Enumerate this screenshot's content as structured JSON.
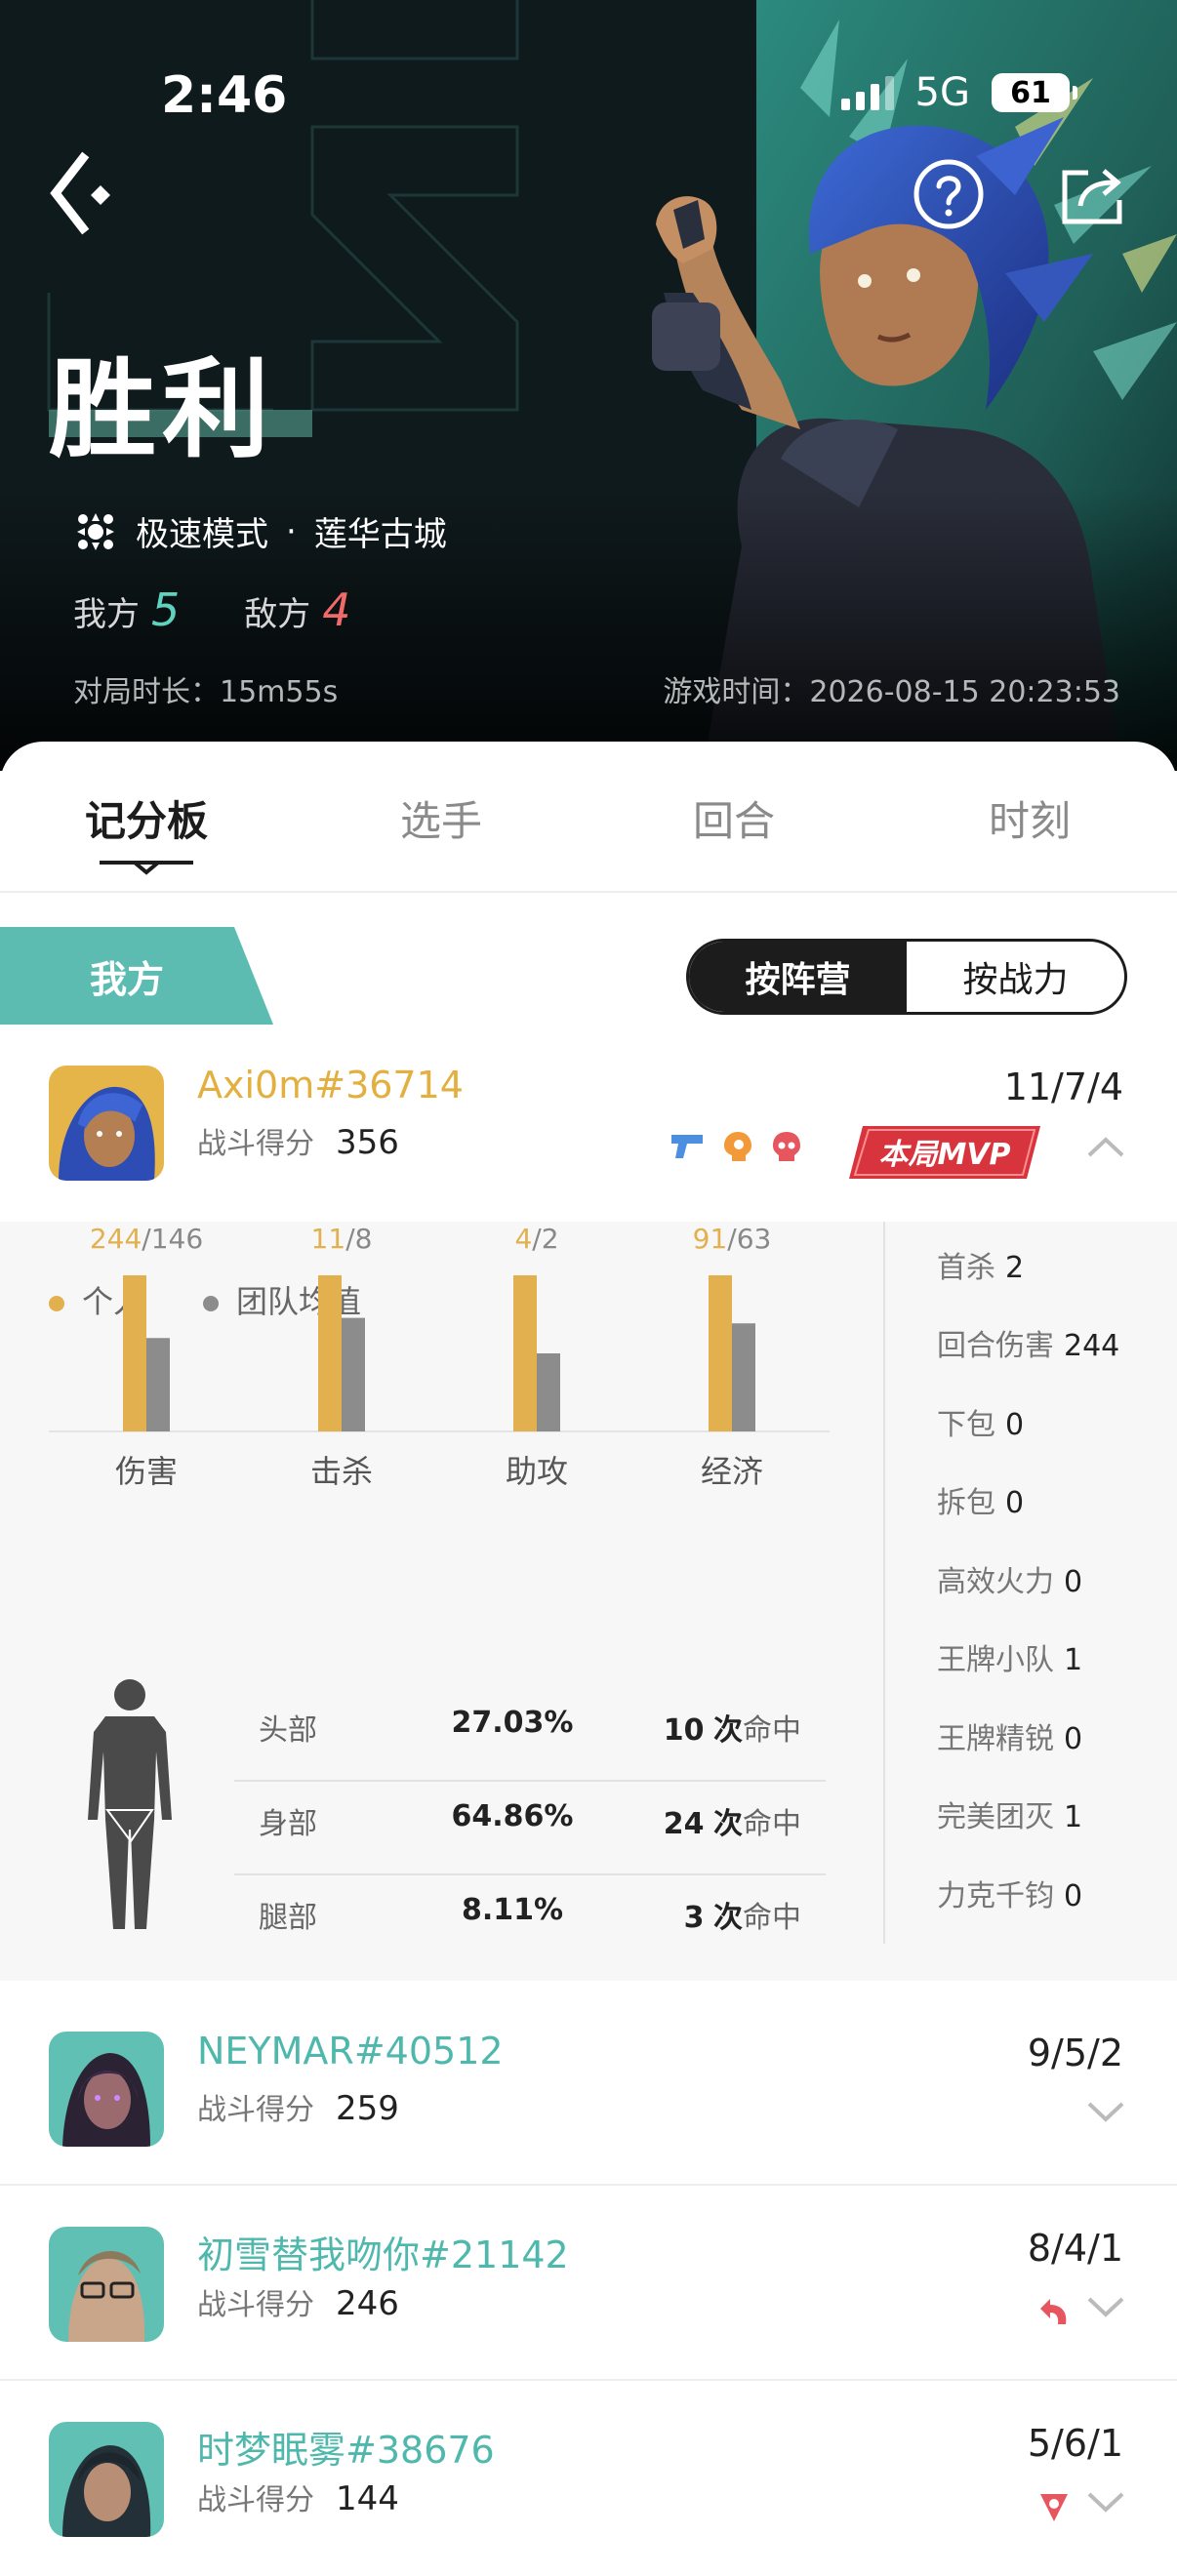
{
  "status_bar": {
    "time": "2:46",
    "network": "5G",
    "battery": "61"
  },
  "header": {
    "result": "胜利",
    "mode": "极速模式",
    "separator": "·",
    "map": "莲华古城",
    "ally_label": "我方",
    "ally_score": "5",
    "enemy_label": "敌方",
    "enemy_score": "4",
    "duration_label": "对局时长：",
    "duration": "15m55s",
    "game_time_label": "游戏时间：",
    "game_time": "2026-08-15 20:23:53"
  },
  "tabs": [
    {
      "label": "记分板",
      "active": true
    },
    {
      "label": "选手",
      "active": false
    },
    {
      "label": "回合",
      "active": false
    },
    {
      "label": "时刻",
      "active": false
    }
  ],
  "team_section": {
    "label": "我方"
  },
  "sort_toggle": {
    "options": [
      "按阵营",
      "按战力"
    ],
    "selected": "按阵营"
  },
  "score_label": "战斗得分",
  "players": [
    {
      "name": "Axi0m#36714",
      "score": "356",
      "kda": "11/7/4",
      "name_color": "#e3b040",
      "expanded": true,
      "mvp": "本局MVP"
    },
    {
      "name": "NEYMAR#40512",
      "score": "259",
      "kda": "9/5/2",
      "name_color": "#4fb8ad",
      "expanded": false
    },
    {
      "name": "初雪替我吻你#21142",
      "score": "246",
      "kda": "8/4/1",
      "name_color": "#4fb8ad",
      "expanded": false
    },
    {
      "name": "时梦眠雾#38676",
      "score": "144",
      "kda": "5/6/1",
      "name_color": "#4fb8ad",
      "expanded": false
    }
  ],
  "detail": {
    "legend_personal": "个人",
    "legend_team_avg": "团队均值",
    "stats_side": [
      {
        "label": "首杀",
        "value": "2"
      },
      {
        "label": "回合伤害",
        "value": "244"
      },
      {
        "label": "下包",
        "value": "0"
      },
      {
        "label": "拆包",
        "value": "0"
      },
      {
        "label": "高效火力",
        "value": "0"
      },
      {
        "label": "王牌小队",
        "value": "1"
      },
      {
        "label": "王牌精锐",
        "value": "0"
      },
      {
        "label": "完美团灭",
        "value": "1"
      },
      {
        "label": "力克千钧",
        "value": "0"
      }
    ],
    "hits": [
      {
        "part": "头部",
        "pct": "27.03%",
        "count": "10",
        "unit": "次",
        "suffix": "命中"
      },
      {
        "part": "身部",
        "pct": "64.86%",
        "count": "24",
        "unit": "次",
        "suffix": "命中"
      },
      {
        "part": "腿部",
        "pct": "8.11%",
        "count": "3",
        "unit": "次",
        "suffix": "命中"
      }
    ]
  },
  "chart_data": {
    "type": "bar",
    "categories": [
      "伤害",
      "击杀",
      "助攻",
      "经济"
    ],
    "series": [
      {
        "name": "个人",
        "values": [
          244,
          11,
          4,
          91
        ],
        "color": "#e2b04e"
      },
      {
        "name": "团队均值",
        "values": [
          146,
          8,
          2,
          63
        ],
        "color": "#8c8c8c"
      }
    ],
    "value_labels": [
      "244",
      "146",
      "11",
      "8",
      "4",
      "2",
      "91",
      "63"
    ],
    "separator": "/",
    "grid": false,
    "legend": "top-left"
  },
  "colors": {
    "accent_teal": "#5cbcb2",
    "gold": "#e3b040",
    "dark": "#1c1c1c",
    "enemy_red": "#f06a6a"
  }
}
